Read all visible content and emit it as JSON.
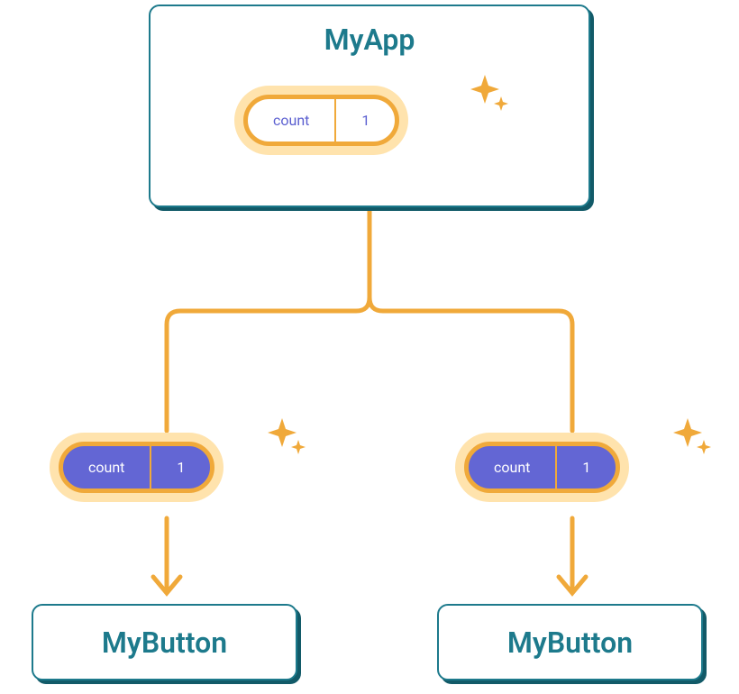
{
  "parent": {
    "title": "MyApp",
    "state": {
      "label": "count",
      "value": "1"
    }
  },
  "children": [
    {
      "title": "MyButton",
      "prop": {
        "label": "count",
        "value": "1"
      }
    },
    {
      "title": "MyButton",
      "prop": {
        "label": "count",
        "value": "1"
      }
    }
  ],
  "colors": {
    "box_border": "#1d7a8c",
    "pill_border": "#f0a93a",
    "pill_glow": "#ffe3ad",
    "pill_fill_dark": "#6366d4",
    "text_purple": "#5a5ed0"
  }
}
